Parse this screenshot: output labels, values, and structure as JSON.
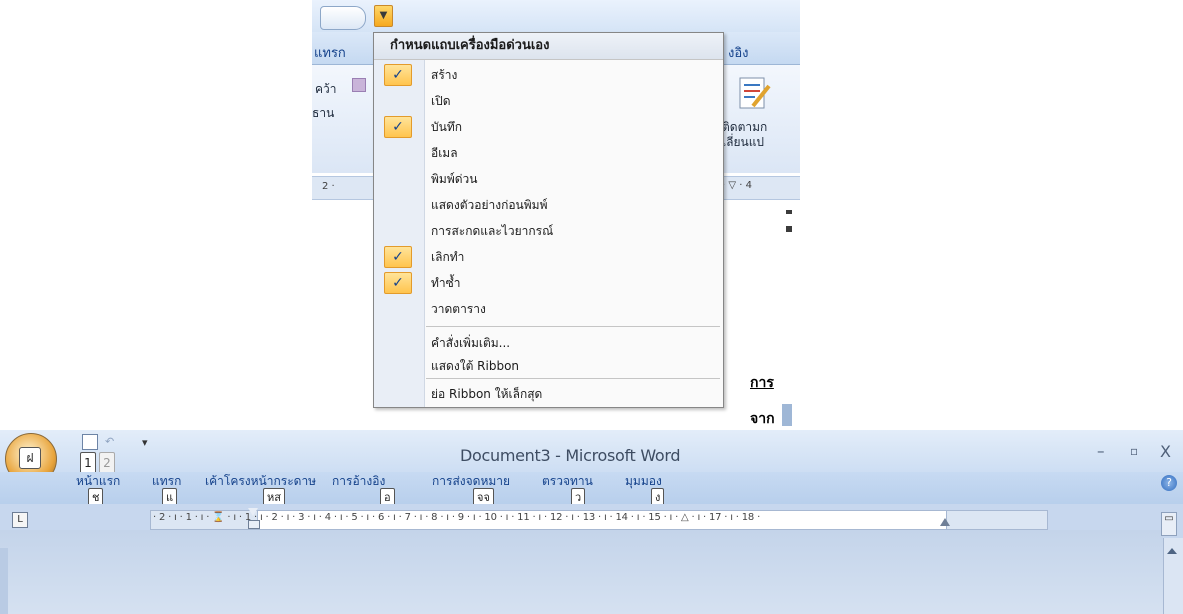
{
  "upper": {
    "tab_left_partial": "แทรก",
    "tab_right_partial": "งอิง",
    "ribbon_left_line1": "คว้า",
    "ribbon_left_line2": "ธาน",
    "ribbon_right_line1": "ติดตามก",
    "ribbon_right_line2": "เลี่ยนแป",
    "ruler_left": "2 ·",
    "ruler_right": "· ▽ · 4",
    "doc_text_1": "การ",
    "doc_text_2": "จาก"
  },
  "menu": {
    "title": "กำหนดแถบเครื่องมือด่วนเอง",
    "items": [
      {
        "label": "สร้าง",
        "checked": true
      },
      {
        "label": "เปิด",
        "checked": false
      },
      {
        "label": "บันทึก",
        "checked": true
      },
      {
        "label": "อีเมล",
        "checked": false
      },
      {
        "label": "พิมพ์ด่วน",
        "checked": false
      },
      {
        "label": "แสดงตัวอย่างก่อนพิมพ์",
        "checked": false
      },
      {
        "label": "การสะกดและไวยากรณ์",
        "checked": false
      },
      {
        "label": "เลิกทำ",
        "checked": true
      },
      {
        "label": "ทำซ้ำ",
        "checked": true
      },
      {
        "label": "วาดตาราง",
        "checked": false
      }
    ],
    "more_commands": "คำสั่งเพิ่มเติม...",
    "show_below_ribbon": "แสดงใต้ Ribbon",
    "minimize_ribbon": "ย่อ Ribbon ให้เล็กสุด",
    "check_glyph": "✓"
  },
  "word": {
    "window_title": "Document3 - Microsoft Word",
    "office_key": "ฝ",
    "qat_key_1": "1",
    "qat_key_2": "2",
    "qat_more": "▾",
    "minimize": "–",
    "maximize": "▫",
    "close": "X",
    "help": "?",
    "tab_selector": "L",
    "tabs": [
      {
        "label": "หน้าแรก",
        "key": "ช"
      },
      {
        "label": "แทรก",
        "key": "แ"
      },
      {
        "label": "เค้าโครงหน้ากระดาษ",
        "key": "หส"
      },
      {
        "label": "การอ้างอิง",
        "key": "อ"
      },
      {
        "label": "การส่งจดหมาย",
        "key": "จจ"
      },
      {
        "label": "ตรวจทาน",
        "key": "ว"
      },
      {
        "label": "มุมมอง",
        "key": "ง"
      }
    ],
    "ruler_ticks": "· 2 · ı · 1 · ı · ⌛ · ı · 1 · ı · 2 · ı · 3 · ı · 4 · ı · 5 · ı · 6 · ı · 7 · ı · 8 · ı · 9 · ı · 10 · ı · 11 · ı · 12 · ı · 13 · ı · 14 · ı · 15 · ı · △ · ı · 17 · ı · 18 ·"
  }
}
